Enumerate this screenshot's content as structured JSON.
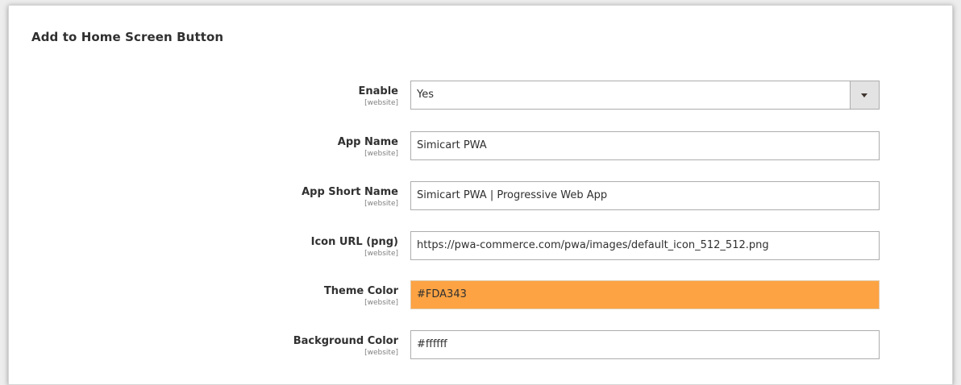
{
  "section": {
    "title": "Add to Home Screen Button"
  },
  "fields": {
    "enable": {
      "label": "Enable",
      "scope": "[website]",
      "value": "Yes"
    },
    "app_name": {
      "label": "App Name",
      "scope": "[website]",
      "value": "Simicart PWA"
    },
    "app_short_name": {
      "label": "App Short Name",
      "scope": "[website]",
      "value": "Simicart PWA | Progressive Web App"
    },
    "icon_url": {
      "label": "Icon URL (png)",
      "scope": "[website]",
      "value": "https://pwa-commerce.com/pwa/images/default_icon_512_512.png"
    },
    "theme_color": {
      "label": "Theme Color",
      "scope": "[website]",
      "value": "#FDA343"
    },
    "background_color": {
      "label": "Background Color",
      "scope": "[website]",
      "value": "#ffffff"
    }
  },
  "colors": {
    "theme_swatch": "#FDA343",
    "border": "#ADADAD",
    "select_button_bg": "#E3E3E3"
  },
  "icons": {
    "select_arrow": "chevron-down-icon"
  }
}
